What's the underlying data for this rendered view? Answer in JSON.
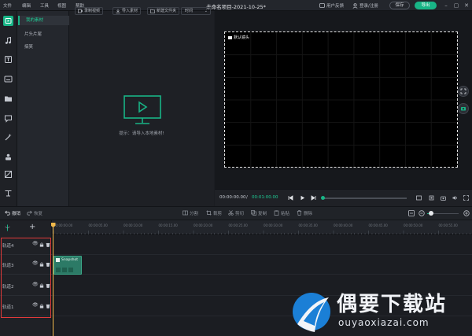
{
  "menu": [
    "文件",
    "编辑",
    "工具",
    "视图",
    "帮助"
  ],
  "app_title": "未命名项目-2021-10-25*",
  "titlebar": {
    "feedback": "用户反馈",
    "login": "登录/注册",
    "save_label": "保存",
    "export_label": "导出"
  },
  "rail_icons": [
    "media-icon",
    "music-icon",
    "text-icon",
    "subtitle-icon",
    "folder-icon",
    "comment-icon",
    "effects-icon",
    "sticker-icon",
    "filter-icon",
    "transition-icon"
  ],
  "library": {
    "items": [
      {
        "label": "我的素材",
        "active": true
      },
      {
        "label": "片头片尾",
        "active": false
      },
      {
        "label": "搞笑",
        "active": false
      }
    ]
  },
  "media_toolbar": {
    "record": "录制视频",
    "import": "导入素材",
    "new_folder": "新建文件夹",
    "sort_value": "时间"
  },
  "media_empty_hint": "提示：请导入本地素材!",
  "preview": {
    "canvas_label": "默认镜头"
  },
  "transport": {
    "current_time": "00:00:00.00",
    "separator": "/",
    "total_time": "00:01:00.00"
  },
  "edit_toolbar": {
    "undo": "撤销",
    "redo": "恢复",
    "split": "分割",
    "crop": "裁剪",
    "cut": "剪切",
    "copy": "复制",
    "paste": "粘贴",
    "delete": "删除"
  },
  "ruler_ticks": [
    "00:00:00.00",
    "00:00:05.00",
    "00:00:10.00",
    "00:00:15.00",
    "00:00:20.00",
    "00:00:25.00",
    "00:00:30.00",
    "00:00:35.00",
    "00:00:40.00",
    "00:00:45.00",
    "00:00:50.00",
    "00:00:55.00"
  ],
  "tracks": [
    {
      "name": "轨道4"
    },
    {
      "name": "轨道3"
    },
    {
      "name": "轨道2"
    },
    {
      "name": "轨道1"
    }
  ],
  "clip": {
    "label": "Snapshot"
  },
  "watermark": {
    "title": "偶要下载站",
    "url": "ouyaoxiazai.com"
  },
  "colors": {
    "accent": "#18b486",
    "highlight": "#e03a3a",
    "playhead": "#f0b84a"
  }
}
